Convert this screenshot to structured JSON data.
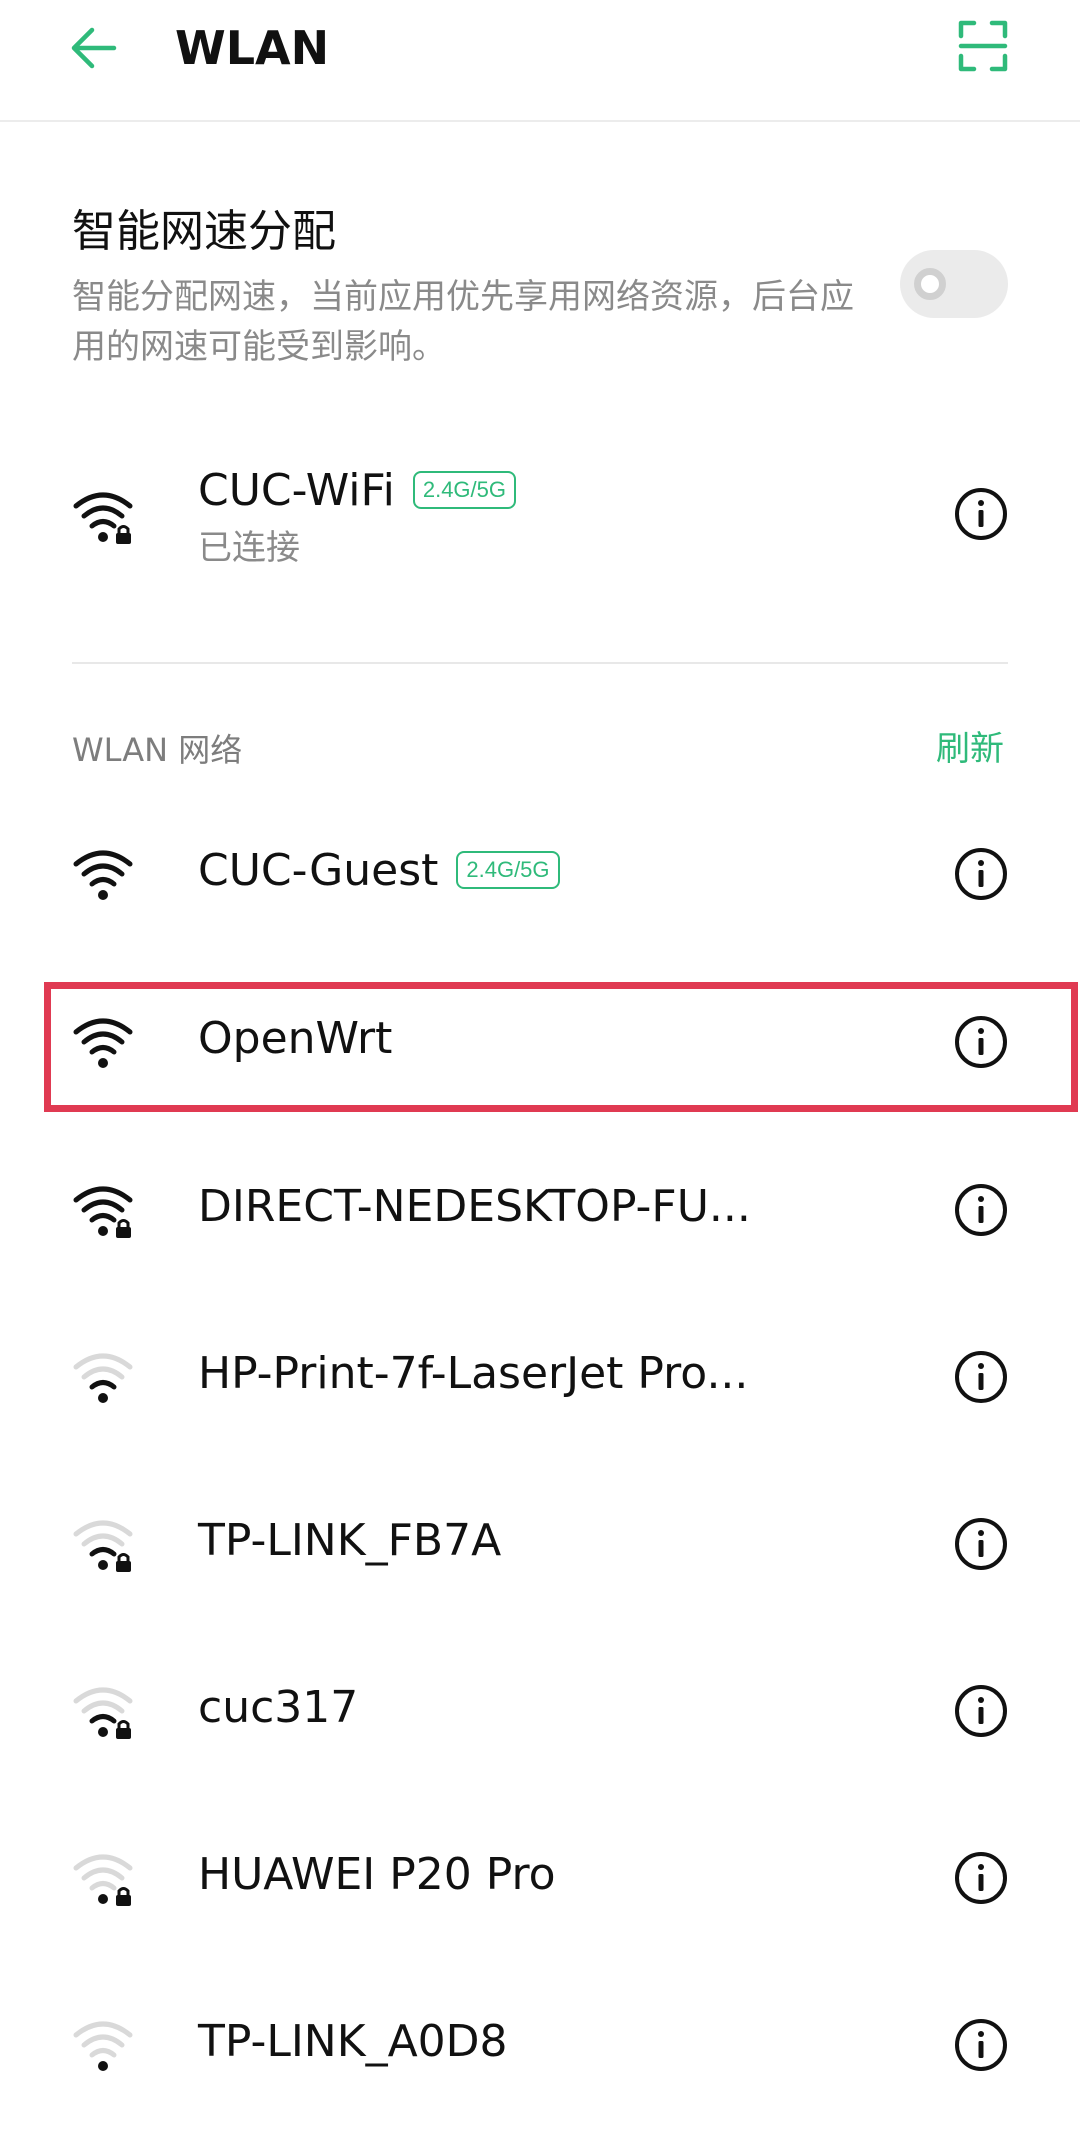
{
  "header": {
    "title": "WLAN"
  },
  "smart_speed": {
    "title": "智能网速分配",
    "description": "智能分配网速，当前应用优先享用网络资源，后台应用的网速可能受到影响。",
    "enabled": false
  },
  "connected": {
    "name": "CUC-WiFi",
    "band": "2.4G/5G",
    "status": "已连接",
    "signal": "full",
    "locked": true
  },
  "section": {
    "label": "WLAN 网络",
    "refresh_label": "刷新"
  },
  "networks": [
    {
      "name": "CUC-Guest",
      "band": "2.4G/5G",
      "signal": "full",
      "locked": false
    },
    {
      "name": "OpenWrt",
      "signal": "full",
      "locked": false
    },
    {
      "name": "DIRECT-NEDESKTOP-FU...",
      "signal": "full",
      "locked": true
    },
    {
      "name": "HP-Print-7f-LaserJet Pro...",
      "signal": "weak",
      "locked": false
    },
    {
      "name": "TP-LINK_FB7A",
      "signal": "weak",
      "locked": true
    },
    {
      "name": "cuc317",
      "signal": "weak",
      "locked": true
    },
    {
      "name": "HUAWEI P20 Pro",
      "signal": "weak",
      "locked": true
    },
    {
      "name": "TP-LINK_A0D8",
      "signal": "weak",
      "locked": false
    }
  ],
  "colors": {
    "accent": "#2fba7a",
    "highlight": "#e03a52",
    "text": "#111111",
    "secondary": "#8a8a8a"
  },
  "icons": {
    "back": "arrow-left-icon",
    "scan": "scan-icon",
    "wifi": "wifi-icon",
    "info": "info-icon",
    "lock": "lock-icon"
  }
}
